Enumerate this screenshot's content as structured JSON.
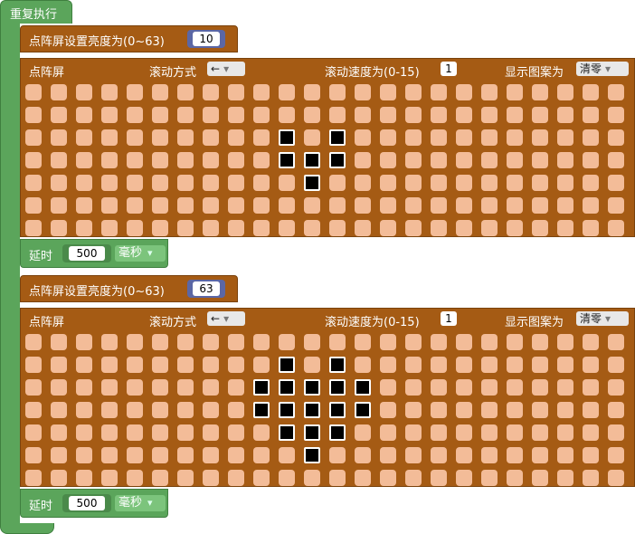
{
  "repeat": {
    "label": "重复执行"
  },
  "blocks": [
    {
      "brightness_label": "点阵屏设置亮度为(0~63)",
      "brightness_value": "10",
      "matrix": {
        "title": "点阵屏",
        "scroll_mode_label": "滚动方式",
        "scroll_mode_value": "←",
        "scroll_speed_label": "滚动速度为(0-15)",
        "scroll_speed_value": "1",
        "pattern_label": "显示图案为",
        "pattern_value": "清零",
        "rows": 7,
        "cols": 24,
        "lit": [
          [
            2,
            10
          ],
          [
            2,
            12
          ],
          [
            3,
            10
          ],
          [
            3,
            11
          ],
          [
            3,
            12
          ],
          [
            4,
            11
          ]
        ]
      },
      "delay": {
        "label": "延时",
        "value": "500",
        "unit": "毫秒"
      }
    },
    {
      "brightness_label": "点阵屏设置亮度为(0~63)",
      "brightness_value": "63",
      "matrix": {
        "title": "点阵屏",
        "scroll_mode_label": "滚动方式",
        "scroll_mode_value": "←",
        "scroll_speed_label": "滚动速度为(0-15)",
        "scroll_speed_value": "1",
        "pattern_label": "显示图案为",
        "pattern_value": "清零",
        "rows": 7,
        "cols": 24,
        "lit": [
          [
            1,
            10
          ],
          [
            1,
            12
          ],
          [
            2,
            9
          ],
          [
            2,
            10
          ],
          [
            2,
            11
          ],
          [
            2,
            12
          ],
          [
            2,
            13
          ],
          [
            3,
            9
          ],
          [
            3,
            10
          ],
          [
            3,
            11
          ],
          [
            3,
            12
          ],
          [
            3,
            13
          ],
          [
            4,
            10
          ],
          [
            4,
            11
          ],
          [
            4,
            12
          ],
          [
            5,
            11
          ]
        ]
      },
      "delay": {
        "label": "延时",
        "value": "500",
        "unit": "毫秒"
      }
    }
  ]
}
